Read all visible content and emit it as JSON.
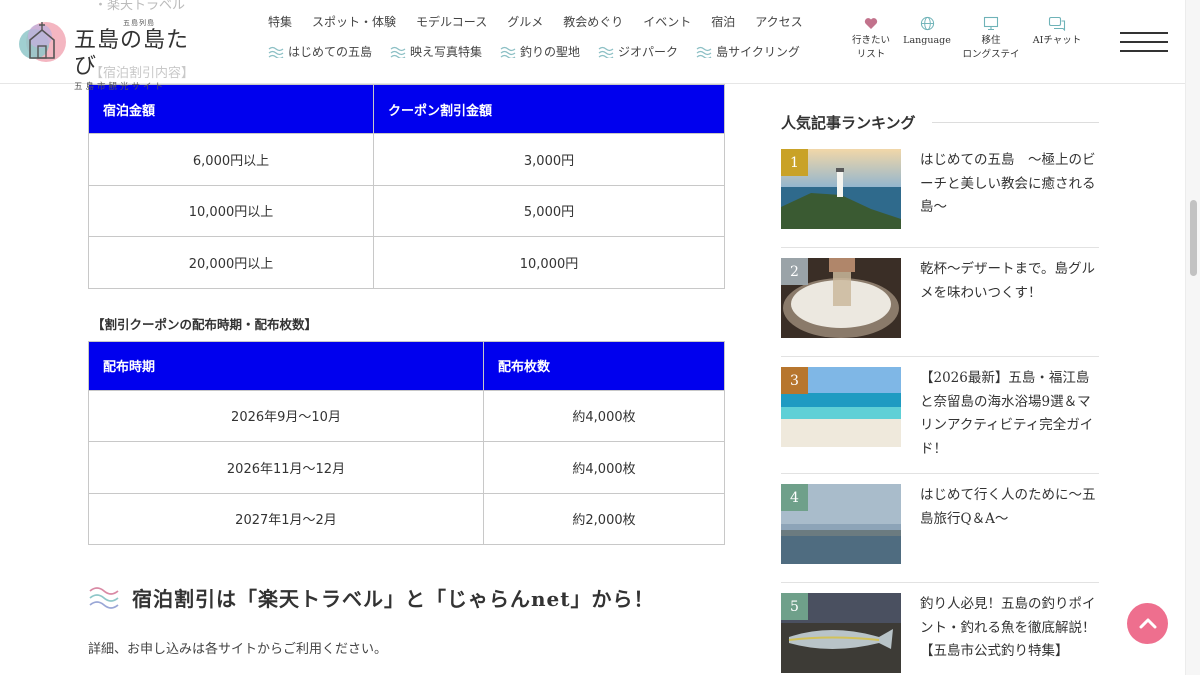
{
  "header": {
    "logo": {
      "small": "五島列島",
      "main": "五島の島たび",
      "sub": "五島市観光サイト"
    },
    "ghost_top": "・楽天トラベル",
    "ghost_bottom": "【宿泊割引内容】",
    "nav_top": [
      "特集",
      "スポット・体験",
      "モデルコース",
      "グルメ",
      "教会めぐり",
      "イベント",
      "宿泊",
      "アクセス"
    ],
    "nav_sub": [
      "はじめての五島",
      "映え写真特集",
      "釣りの聖地",
      "ジオパーク",
      "島サイクリング"
    ],
    "utilities": {
      "wishlist": {
        "line1": "行きたい",
        "line2": "リスト"
      },
      "language": "Language",
      "longstay": {
        "line1": "移住",
        "line2": "ロングステイ"
      },
      "chat": "AIチャット"
    }
  },
  "table1": {
    "headers": [
      "宿泊金額",
      "クーポン割引金額"
    ],
    "rows": [
      [
        "6,000円以上",
        "3,000円"
      ],
      [
        "10,000円以上",
        "5,000円"
      ],
      [
        "20,000円以上",
        "10,000円"
      ]
    ]
  },
  "table2_label": "【割引クーポンの配布時期・配布枚数】",
  "table2": {
    "headers": [
      "配布時期",
      "配布枚数"
    ],
    "rows": [
      [
        "2026年9月〜10月",
        "約4,000枚"
      ],
      [
        "2026年11月〜12月",
        "約4,000枚"
      ],
      [
        "2027年1月〜2月",
        "約2,000枚"
      ]
    ]
  },
  "section_heading": "宿泊割引は「楽天トラベル」と「じゃらんnet」から！",
  "section_text": "詳細、お申し込みは各サイトからご利用ください。",
  "sidebar": {
    "title": "人気記事ランキング",
    "items": [
      {
        "rank": "1",
        "badge_color": "#c9a227",
        "title": "はじめての五島　～極上のビーチと美しい教会に癒される島～"
      },
      {
        "rank": "2",
        "badge_color": "#9aa3a8",
        "title": "乾杯～デザートまで。島グルメを味わいつくす！"
      },
      {
        "rank": "3",
        "badge_color": "#b7762e",
        "title": "【2026最新】五島・福江島と奈留島の海水浴場9選＆マリンアクティビティ完全ガイド！"
      },
      {
        "rank": "4",
        "badge_color": "#6fa08a",
        "title": "はじめて行く人のために～五島旅行Q＆A～"
      },
      {
        "rank": "5",
        "badge_color": "#6fa08a",
        "title": "釣り人必見！五島の釣りポイント・釣れる魚を徹底解説！【五島市公式釣り特集】"
      }
    ]
  },
  "colors": {
    "table_header": "#0000ee",
    "accent_pink": "#ee6f8e",
    "wave_teal": "#6fb3b8"
  }
}
